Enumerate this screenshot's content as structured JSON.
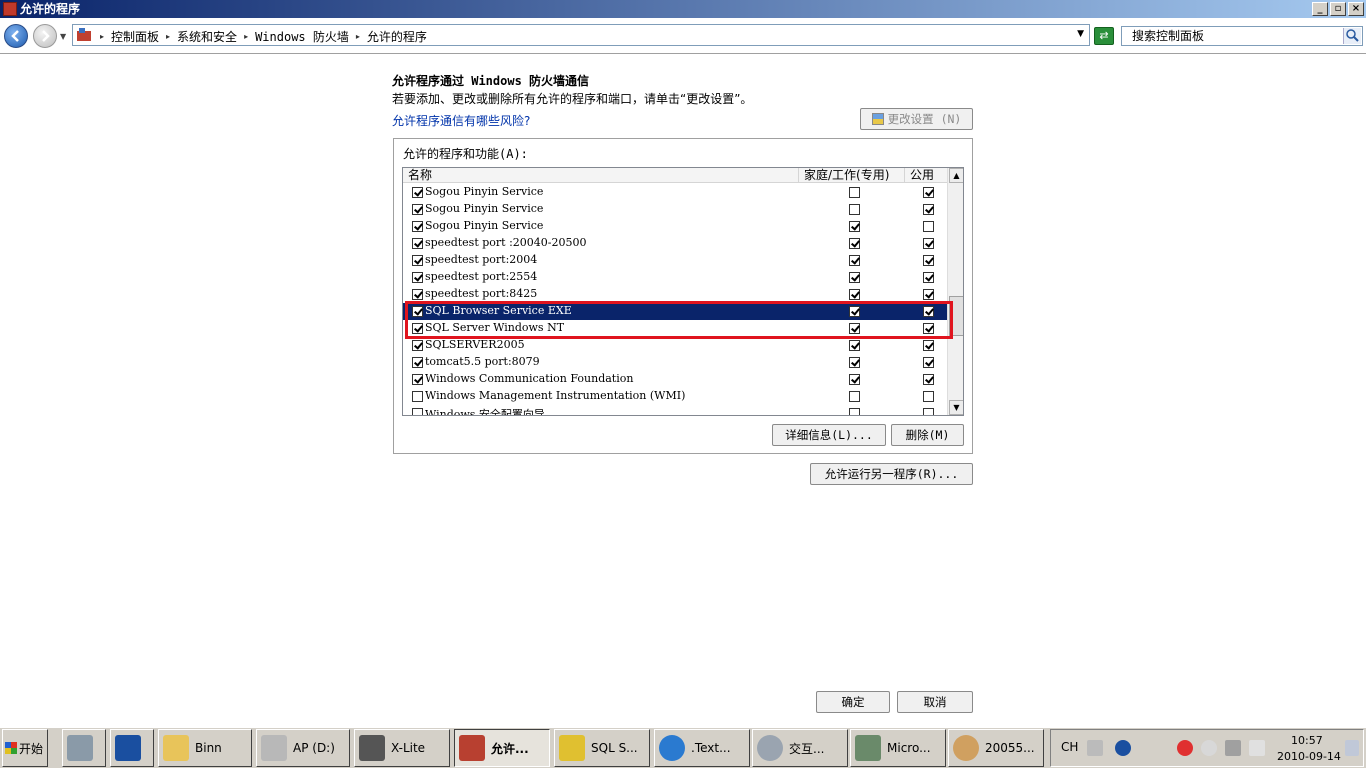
{
  "window": {
    "title": "允许的程序"
  },
  "breadcrumbs": [
    "控制面板",
    "系统和安全",
    "Windows 防火墙",
    "允许的程序"
  ],
  "search": {
    "placeholder": "搜索控制面板"
  },
  "page": {
    "heading": "允许程序通过 Windows 防火墙通信",
    "subtext": "若要添加、更改或删除所有允许的程序和端口，请单击“更改设置”。",
    "risk_link": "允许程序通信有哪些风险?",
    "change_settings_label": "更改设置 (N)",
    "group_label": "允许的程序和功能(A):",
    "details_label": "详细信息(L)...",
    "delete_label": "删除(M)",
    "allow_another_label": "允许运行另一程序(R)...",
    "ok_label": "确定",
    "cancel_label": "取消"
  },
  "table": {
    "columns": {
      "name": "名称",
      "home": "家庭/工作(专用)",
      "public": "公用"
    },
    "rows": [
      {
        "name": "Sogou Pinyin Service",
        "enabled": true,
        "home": false,
        "public": true,
        "selected": false
      },
      {
        "name": "Sogou Pinyin Service",
        "enabled": true,
        "home": false,
        "public": true,
        "selected": false
      },
      {
        "name": "Sogou Pinyin Service",
        "enabled": true,
        "home": true,
        "public": false,
        "selected": false
      },
      {
        "name": "speedtest port :20040-20500",
        "enabled": true,
        "home": true,
        "public": true,
        "selected": false
      },
      {
        "name": "speedtest port:2004",
        "enabled": true,
        "home": true,
        "public": true,
        "selected": false
      },
      {
        "name": "speedtest port:2554",
        "enabled": true,
        "home": true,
        "public": true,
        "selected": false
      },
      {
        "name": "speedtest port:8425",
        "enabled": true,
        "home": true,
        "public": true,
        "selected": false
      },
      {
        "name": "SQL Browser Service EXE",
        "enabled": true,
        "home": true,
        "public": true,
        "selected": true
      },
      {
        "name": "SQL Server Windows NT",
        "enabled": true,
        "home": true,
        "public": true,
        "selected": false
      },
      {
        "name": "SQLSERVER2005",
        "enabled": true,
        "home": true,
        "public": true,
        "selected": false
      },
      {
        "name": "tomcat5.5 port:8079",
        "enabled": true,
        "home": true,
        "public": true,
        "selected": false
      },
      {
        "name": "Windows Communication Foundation",
        "enabled": true,
        "home": true,
        "public": true,
        "selected": false
      },
      {
        "name": "Windows Management Instrumentation (WMI)",
        "enabled": false,
        "home": false,
        "public": false,
        "selected": false
      },
      {
        "name": "Windows 安全配置向导",
        "enabled": false,
        "home": false,
        "public": false,
        "selected": false
      }
    ]
  },
  "taskbar": {
    "start_label": "开始",
    "tasks": [
      "Binn",
      "AP (D:)",
      "X-Lite",
      "允许...",
      "SQL S...",
      ".Text...",
      "交互...",
      "Micro...",
      "20055..."
    ],
    "lang": "CH",
    "time": "10:57",
    "date": "2010-09-14"
  },
  "colors": {
    "selection": "#0a246a",
    "highlight_border": "#e0141e",
    "link": "#0033aa"
  }
}
